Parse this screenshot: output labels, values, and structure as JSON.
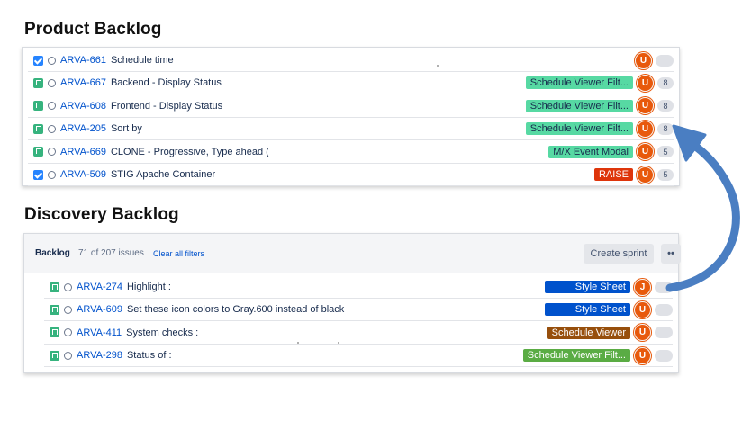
{
  "product_backlog": {
    "heading": "Product Backlog",
    "rows": [
      {
        "type": "task",
        "key": "ARVA-661",
        "summary": "Schedule time",
        "epic": "",
        "epic_color": "",
        "avatar": "U",
        "points": ""
      },
      {
        "type": "story",
        "key": "ARVA-667",
        "summary": "Backend - Display Status",
        "epic": "Schedule Viewer Filt...",
        "epic_color": "#57d9a3",
        "avatar": "U",
        "points": "8"
      },
      {
        "type": "story",
        "key": "ARVA-608",
        "summary": "Frontend - Display Status",
        "epic": "Schedule Viewer Filt...",
        "epic_color": "#57d9a3",
        "avatar": "U",
        "points": "8"
      },
      {
        "type": "story",
        "key": "ARVA-205",
        "summary": "Sort by",
        "epic": "Schedule Viewer Filt...",
        "epic_color": "#57d9a3",
        "avatar": "U",
        "points": "8"
      },
      {
        "type": "story",
        "key": "ARVA-669",
        "summary": "CLONE - Progressive, Type ahead (",
        "epic": "M/X Event Modal",
        "epic_color": "#57d9a3",
        "avatar": "U",
        "points": "5"
      },
      {
        "type": "task",
        "key": "ARVA-509",
        "summary": "STIG Apache Container",
        "epic": "RAISE",
        "epic_color": "#de350b",
        "avatar": "U",
        "points": "5"
      }
    ]
  },
  "discovery_backlog": {
    "heading": "Discovery Backlog",
    "toolbar": {
      "backlog_label": "Backlog",
      "issue_count": "71 of 207 issues",
      "clear_filters": "Clear all filters",
      "create_sprint": "Create sprint",
      "more": "••"
    },
    "rows": [
      {
        "type": "story",
        "key": "ARVA-274",
        "summary": "Highlight :",
        "epic": "Style Sheet",
        "epic_color": "#0052cc",
        "avatar": "J",
        "points": ""
      },
      {
        "type": "story",
        "key": "ARVA-609",
        "summary": "Set these icon colors to Gray.600 instead of black",
        "epic": "Style Sheet",
        "epic_color": "#0052cc",
        "avatar": "U",
        "points": ""
      },
      {
        "type": "story",
        "key": "ARVA-411",
        "summary": "System checks :",
        "epic": "Schedule Viewer",
        "epic_color": "#974f0c",
        "avatar": "U",
        "points": ""
      },
      {
        "type": "story",
        "key": "ARVA-298",
        "summary": "Status of :",
        "epic": "Schedule Viewer Filt...",
        "epic_color": "#5aac44",
        "avatar": "U",
        "points": ""
      }
    ]
  },
  "colors": {
    "arrow": "#4a7ec2",
    "link": "#0052cc",
    "avatar": "#e8590c"
  }
}
